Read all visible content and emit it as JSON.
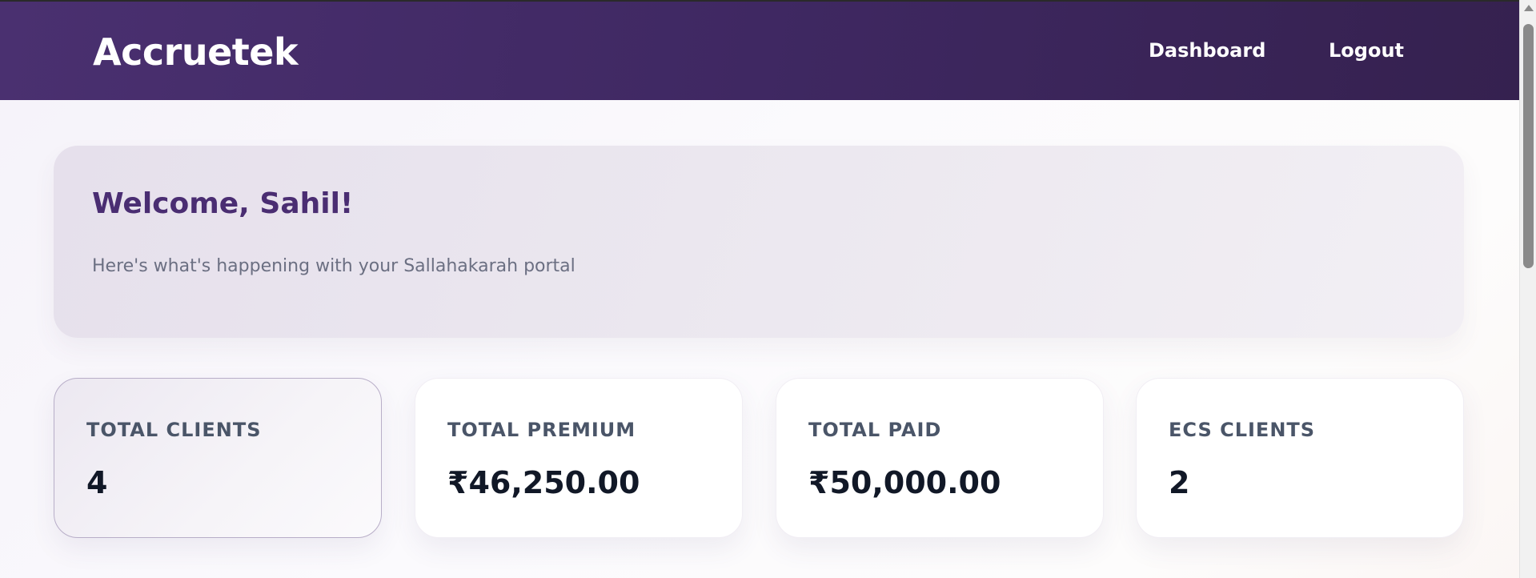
{
  "navbar": {
    "brand": "Accruetek",
    "links": [
      "Dashboard",
      "Logout"
    ]
  },
  "welcome": {
    "title": "Welcome, Sahil!",
    "subtitle": "Here's what's happening with your Sallahakarah portal"
  },
  "stats": [
    {
      "label": "TOTAL CLIENTS",
      "value": "4"
    },
    {
      "label": "TOTAL PREMIUM",
      "value": "₹46,250.00"
    },
    {
      "label": "TOTAL PAID",
      "value": "₹50,000.00"
    },
    {
      "label": "ECS CLIENTS",
      "value": "2"
    }
  ],
  "colors": {
    "navbar": "#3f2862",
    "accent": "#4a2d72",
    "subtitle_text": "#6b6f82"
  }
}
